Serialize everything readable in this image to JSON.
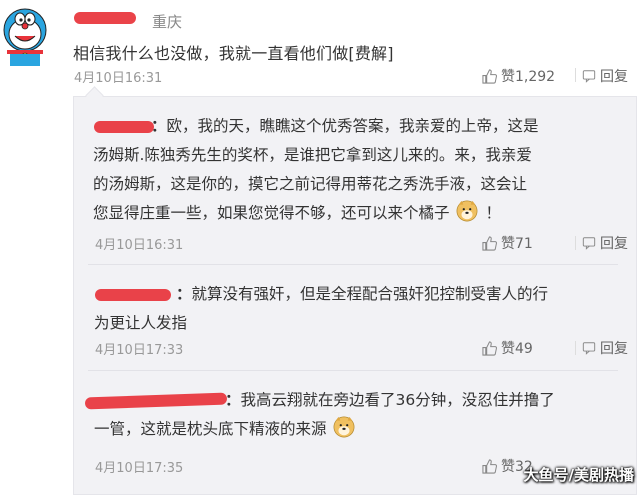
{
  "post": {
    "location": "重庆",
    "text": "相信我什么也没做，我就一直看他们做[费解]",
    "date": "4月10日16:31",
    "likes": "赞1,292",
    "reply_label": "回复"
  },
  "replies": [
    {
      "text_line1": "欧，我的天，瞧瞧这个优秀答案，我亲爱的上帝，这是",
      "text_line2": "汤姆斯.陈独秀先生的奖杯，是谁把它拿到这儿来的。来，我亲爱",
      "text_line3": "的汤姆斯，这是你的，摸它之前记得用蒂花之秀洗手液，这会让",
      "text_line4": "您显得庄重一些，如果您觉得不够，还可以来个橘子",
      "text_line4_end": "！",
      "date": "4月10日16:31",
      "likes": "赞71",
      "reply_label": "回复"
    },
    {
      "text_line1": "就算没有强奸，但是全程配合强奸犯控制受害人的行",
      "text_line2": "为更让人发指",
      "date": "4月10日17:33",
      "likes": "赞49",
      "reply_label": "回复"
    },
    {
      "text_line1": "我高云翔就在旁边看了36分钟，没忍住并撸了",
      "text_line2": "一管，这就是枕头底下精液的来源",
      "date": "4月10日17:35",
      "likes": "赞32"
    }
  ],
  "colon": "：",
  "watermark": "大鱼号/美剧热播",
  "icons": {
    "like": "thumbs-up-icon",
    "reply": "reply-icon",
    "emoji": "doge-emoji-icon",
    "avatar": "doraemon-avatar"
  },
  "colors": {
    "redaction": "#e8333a",
    "reply_bg": "#f2f2f5",
    "meta": "#999999"
  }
}
